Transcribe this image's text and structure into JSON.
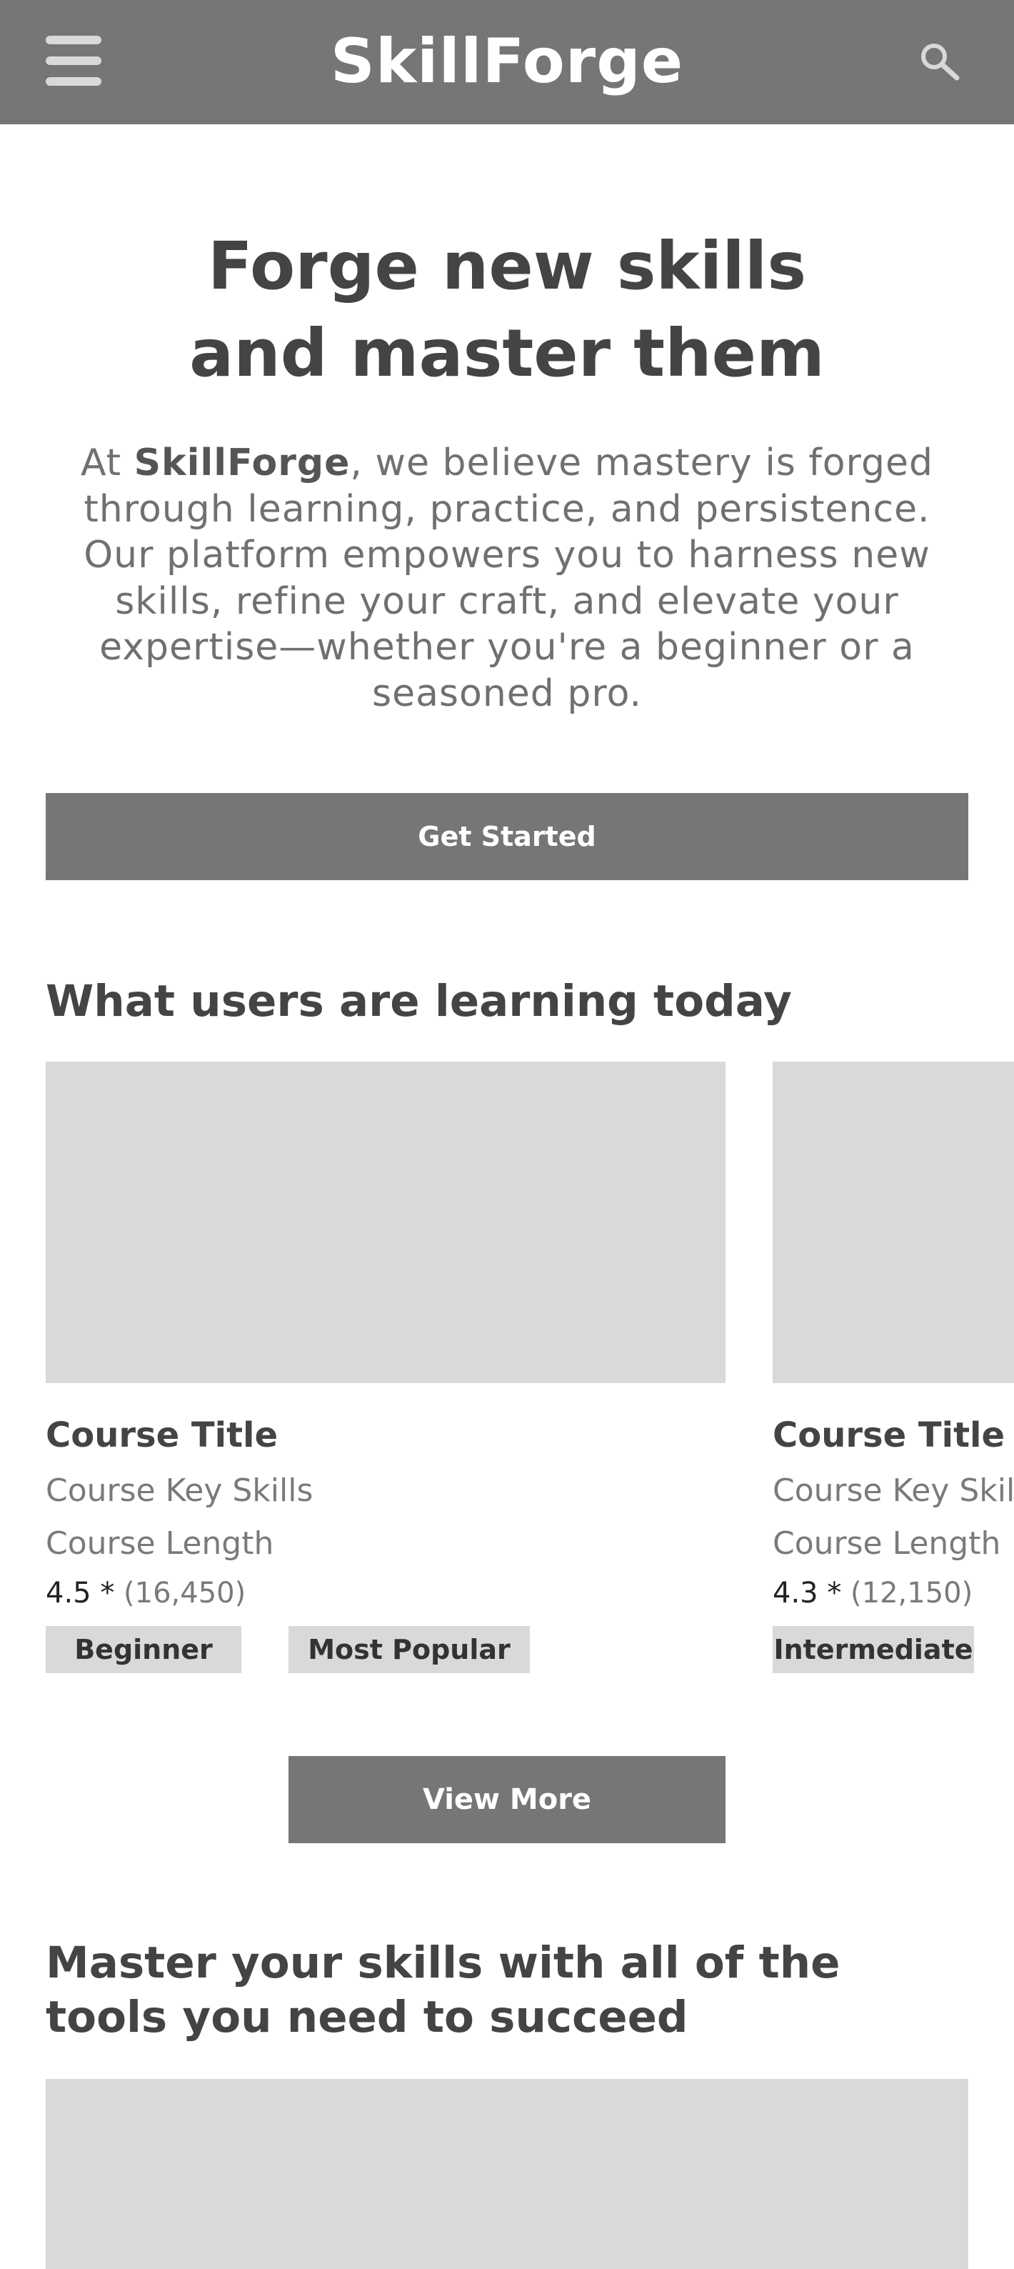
{
  "header": {
    "brand": "SkillForge",
    "menu_icon": "hamburger-menu-icon",
    "search_icon": "search-icon",
    "bar_color": "#767676"
  },
  "hero": {
    "title_line1": "Forge new skills",
    "title_line2": "and master them",
    "text_intro": "At ",
    "text_brand": "SkillForge",
    "text_body": ", we believe mastery is forged through learning, practice, and persistence. Our platform empowers you to harness new skills, refine your craft, and elevate your expertise—whether you're a beginner or a seasoned pro.",
    "cta_label": "Get Started"
  },
  "learning": {
    "heading": "What users are learning today",
    "courses": [
      {
        "title": "Course Title",
        "skills": "Course Key Skills",
        "length": "Course Length",
        "rating": "4.5 *",
        "review_count": "(16,450)",
        "tags": [
          "Beginner",
          "Most Popular"
        ]
      },
      {
        "title": "Course Title",
        "skills": "Course Key Skills",
        "length": "Course Length",
        "rating": "4.3 *",
        "review_count": "(12,150)",
        "tags": [
          "Intermediate"
        ]
      }
    ],
    "more_label": "View More"
  },
  "tools": {
    "heading": "Master your skills with all of the tools you need to succeed"
  }
}
